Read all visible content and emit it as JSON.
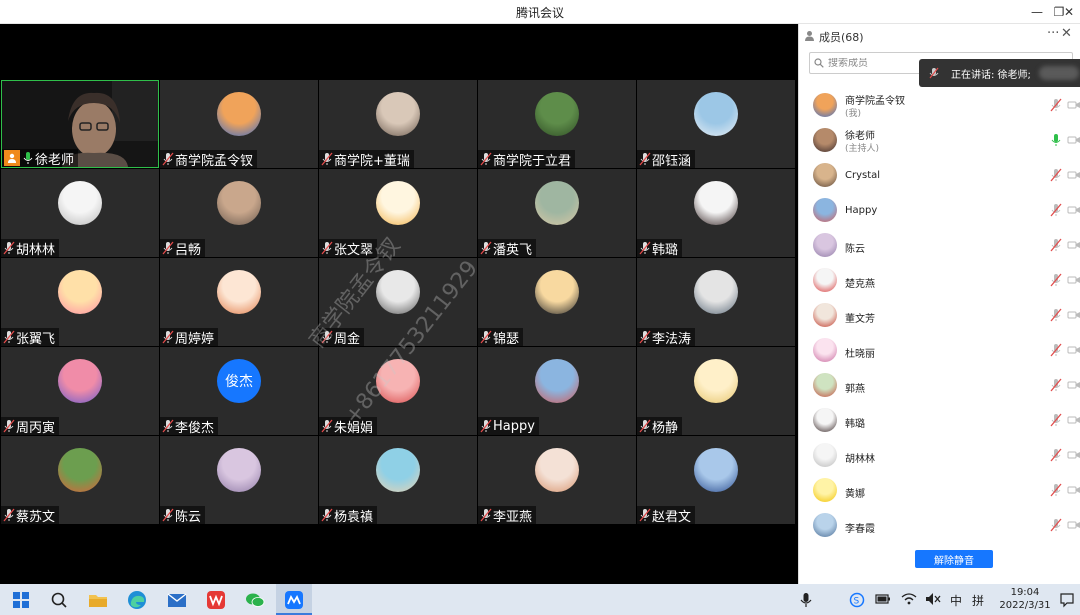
{
  "window": {
    "title": "腾讯会议",
    "min_icon": "minimize-icon",
    "restore_icon": "restore-icon",
    "close_icon": "close-icon"
  },
  "video_grid": {
    "self_name": "徐老师",
    "tiles": [
      {
        "name": "商学院孟令钗",
        "avatar": "monkey-glasses",
        "colors": [
          "#f0a35a",
          "#3a6cc9"
        ]
      },
      {
        "name": "商学院+董瑞",
        "avatar": "couple-photo",
        "colors": [
          "#d9c8b8",
          "#6b5b4f"
        ]
      },
      {
        "name": "商学院于立君",
        "avatar": "green-field-photo",
        "colors": [
          "#5e8d4a",
          "#2f4d25"
        ]
      },
      {
        "name": "邵钰涵",
        "avatar": "yoga-beach-photo",
        "colors": [
          "#9cc7e6",
          "#e9eef3"
        ]
      },
      {
        "name": "胡林林",
        "avatar": "sketch-girl",
        "colors": [
          "#f5f5f5",
          "#b9b9b9"
        ]
      },
      {
        "name": "吕畅",
        "avatar": "man-photo",
        "colors": [
          "#c9a78c",
          "#6a5a4f"
        ]
      },
      {
        "name": "张文翠",
        "avatar": "cartoon-girl",
        "colors": [
          "#fff6e0",
          "#f2b24a"
        ]
      },
      {
        "name": "潘英飞",
        "avatar": "child-photo",
        "colors": [
          "#9fb6a1",
          "#d8c7a5"
        ]
      },
      {
        "name": "韩璐",
        "avatar": "woman-photo",
        "colors": [
          "#f5f5f5",
          "#3a2a2a"
        ]
      },
      {
        "name": "张翼飞",
        "avatar": "cartoon-face",
        "colors": [
          "#ffe0a8",
          "#ff8fa3"
        ]
      },
      {
        "name": "周婷婷",
        "avatar": "cartoon-mouse",
        "colors": [
          "#fde6d4",
          "#e17d4b"
        ]
      },
      {
        "name": "周金",
        "avatar": "landscape-photo",
        "colors": [
          "#e8e8e8",
          "#5a5a5a"
        ]
      },
      {
        "name": "锦瑟",
        "avatar": "cartoon-chibi",
        "colors": [
          "#f8d9a0",
          "#2a2a2a"
        ]
      },
      {
        "name": "李法涛",
        "avatar": "man-outdoor-photo",
        "colors": [
          "#e4e4e4",
          "#5c6b7a"
        ]
      },
      {
        "name": "周丙寅",
        "avatar": "sunset-photo",
        "colors": [
          "#f08ca8",
          "#6a5acd"
        ]
      },
      {
        "name": "李俊杰",
        "avatar": "text-avatar",
        "avatar_text": "俊杰",
        "colors": [
          "#1677ff",
          "#1677ff"
        ]
      },
      {
        "name": "朱娟娟",
        "avatar": "cartoon-pig",
        "colors": [
          "#f7b3b3",
          "#d94a4a"
        ]
      },
      {
        "name": "Happy",
        "avatar": "city-photo",
        "colors": [
          "#8bb5e0",
          "#d05a5a"
        ]
      },
      {
        "name": "杨静",
        "avatar": "cartoon-blonde",
        "colors": [
          "#fff0c9",
          "#e5c46b"
        ]
      },
      {
        "name": "蔡苏文",
        "avatar": "flower-photo",
        "colors": [
          "#6c9e4f",
          "#e0603a"
        ]
      },
      {
        "name": "陈云",
        "avatar": "blossom-photo",
        "colors": [
          "#d9c6e0",
          "#8f7aa6"
        ]
      },
      {
        "name": "杨袁禛",
        "avatar": "beach-photo",
        "colors": [
          "#8fd0e6",
          "#e9d2b2"
        ]
      },
      {
        "name": "李亚燕",
        "avatar": "food-photo",
        "colors": [
          "#f4e1d6",
          "#d8946e"
        ]
      },
      {
        "name": "赵君文",
        "avatar": "mountain-photo",
        "colors": [
          "#a9c8ea",
          "#2b4d8f"
        ]
      }
    ]
  },
  "watermark": {
    "line1": "商学院孟令钗",
    "line2": "+8617753211929"
  },
  "panel": {
    "title": "成员(68)",
    "more_label": "···",
    "close_label": "✕",
    "search_placeholder": "搜索成员",
    "speaking_text": "正在讲话: 徐老师;",
    "members": [
      {
        "name": "商学院孟令钗",
        "sub": "(我)",
        "avatar_colors": [
          "#f0a35a",
          "#3a6cc9"
        ],
        "mic": "muted"
      },
      {
        "name": "徐老师",
        "sub": "(主持人)",
        "avatar_colors": [
          "#b58a6a",
          "#3a2a2a"
        ],
        "mic": "active"
      },
      {
        "name": "Crystal",
        "sub": "",
        "avatar_colors": [
          "#d8b48c",
          "#5a4436"
        ],
        "mic": "muted"
      },
      {
        "name": "Happy",
        "sub": "",
        "avatar_colors": [
          "#8bb5e0",
          "#d05a5a"
        ],
        "mic": "muted"
      },
      {
        "name": "陈云",
        "sub": "",
        "avatar_colors": [
          "#d9c6e0",
          "#8f7aa6"
        ],
        "mic": "muted"
      },
      {
        "name": "楚克燕",
        "sub": "",
        "avatar_colors": [
          "#f5f5f5",
          "#d83a3a"
        ],
        "mic": "muted"
      },
      {
        "name": "董文芳",
        "sub": "",
        "avatar_colors": [
          "#f1e6dc",
          "#c0392b"
        ],
        "mic": "muted"
      },
      {
        "name": "杜晓丽",
        "sub": "",
        "avatar_colors": [
          "#fbe3ef",
          "#c86a9e"
        ],
        "mic": "muted"
      },
      {
        "name": "郭燕",
        "sub": "",
        "avatar_colors": [
          "#cfe3c1",
          "#c24a3b"
        ],
        "mic": "muted"
      },
      {
        "name": "韩璐",
        "sub": "",
        "avatar_colors": [
          "#f5f5f5",
          "#3a2a2a"
        ],
        "mic": "muted"
      },
      {
        "name": "胡林林",
        "sub": "",
        "avatar_colors": [
          "#f5f5f5",
          "#b9b9b9"
        ],
        "mic": "muted"
      },
      {
        "name": "黄娜",
        "sub": "",
        "avatar_colors": [
          "#fff3a6",
          "#f2c200"
        ],
        "mic": "muted"
      },
      {
        "name": "李春霞",
        "sub": "",
        "avatar_colors": [
          "#b9d3ea",
          "#4a6d95"
        ],
        "mic": "muted"
      }
    ],
    "unmute_label": "解除静音"
  },
  "taskbar": {
    "icons": [
      "windows-start-icon",
      "search-icon",
      "file-explorer-icon",
      "edge-browser-icon",
      "mail-icon",
      "wps-office-icon",
      "wechat-icon",
      "tencent-meeting-icon"
    ],
    "tray_ime_mode": "中",
    "tray_ime_layout": "拼",
    "time": "19:04",
    "date": "2022/3/31"
  }
}
